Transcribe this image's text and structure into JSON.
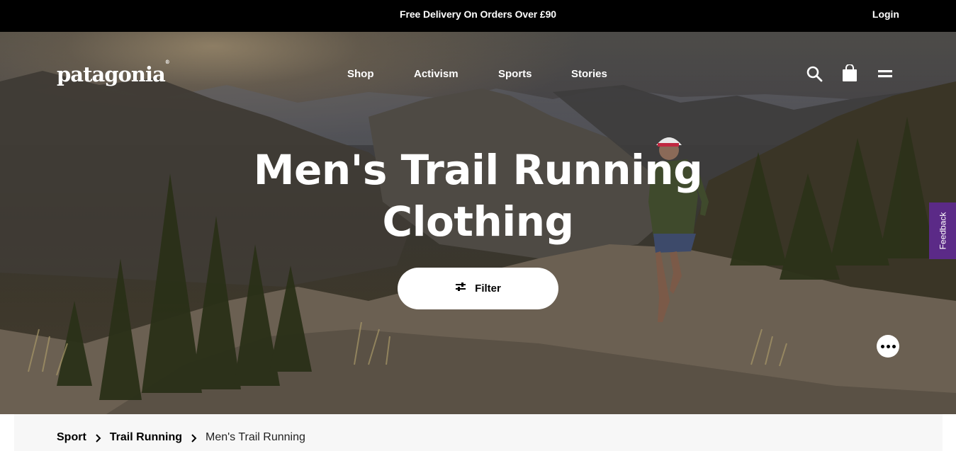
{
  "topbar": {
    "promo": "Free Delivery On Orders Over £90",
    "login": "Login"
  },
  "brand": {
    "logo": "patagonia",
    "trademark": "®"
  },
  "nav": {
    "items": [
      "Shop",
      "Activism",
      "Sports",
      "Stories"
    ]
  },
  "header_icons": [
    "search-icon",
    "shopping-bag-icon",
    "menu-icon"
  ],
  "hero": {
    "title_line1": "Men's Trail Running",
    "title_line2": "Clothing",
    "filter_label": "Filter"
  },
  "feedback": {
    "label": "Feedback",
    "color": "#5b2a87"
  },
  "breadcrumb": {
    "items": [
      "Sport",
      "Trail Running",
      "Men's Trail Running"
    ]
  }
}
